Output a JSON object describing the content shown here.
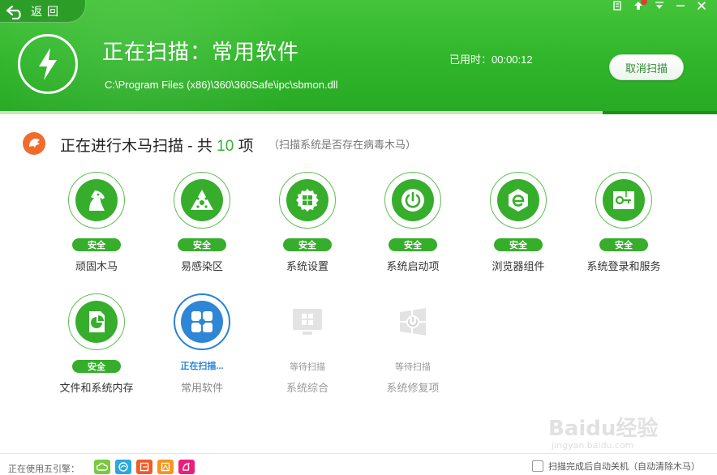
{
  "header": {
    "back_label": "返回",
    "scan_title": "正在扫描：常用软件",
    "scan_path": "C:\\Program Files (x86)\\360\\360Safe\\ipc\\sbmon.dll",
    "elapsed": "已用时：00:00:12",
    "cancel_label": "取消扫描",
    "progress_fraction": 0.84,
    "colors": {
      "green": "#36ae2c",
      "blue": "#2a83d3"
    }
  },
  "window_controls": [
    "skin-icon",
    "upload-icon",
    "menu-down-icon",
    "minimize-icon",
    "close-icon"
  ],
  "section": {
    "title_prefix": "正在进行木马扫描 - 共 ",
    "count": "10",
    "title_suffix": " 项",
    "note": "（扫描系统是否存在病毒木马）"
  },
  "items": [
    {
      "label": "顽固木马",
      "status": "安全",
      "icon": "horse-icon"
    },
    {
      "label": "易感染区",
      "status": "安全",
      "icon": "warning-triangle-icon"
    },
    {
      "label": "系统设置",
      "status": "安全",
      "icon": "gear-windows-icon"
    },
    {
      "label": "系统启动项",
      "status": "安全",
      "icon": "power-icon"
    },
    {
      "label": "浏览器组件",
      "status": "安全",
      "icon": "ie-icon"
    },
    {
      "label": "系统登录和服务",
      "status": "安全",
      "icon": "login-service-icon"
    },
    {
      "label": "文件和系统内存",
      "status": "安全",
      "icon": "file-chart-icon"
    },
    {
      "label": "常用软件",
      "status": "正在扫描...",
      "icon": "apps-icon"
    },
    {
      "label": "系统综合",
      "status": "等待扫描",
      "icon": "monitor-windows-icon"
    },
    {
      "label": "系统修复项",
      "status": "等待扫描",
      "icon": "windows-repair-icon"
    }
  ],
  "footer": {
    "engines_label": "正在使用五引擎：",
    "engines": [
      {
        "icon": "cloud-engine-icon",
        "color": "#7ac943"
      },
      {
        "icon": "qvm-engine-icon",
        "color": "#29a8e0"
      },
      {
        "icon": "qex-engine-icon",
        "color": "#f15a24"
      },
      {
        "icon": "avira-engine-icon",
        "color": "#f7931e"
      },
      {
        "icon": "bitdefender-engine-icon",
        "color": "#ed1e79"
      }
    ],
    "auto_shutdown_label": "扫描完成后自动关机（自动清除木马）"
  },
  "watermark": {
    "text": "Baidu经验",
    "sub": "jingyan.baidu.com"
  }
}
